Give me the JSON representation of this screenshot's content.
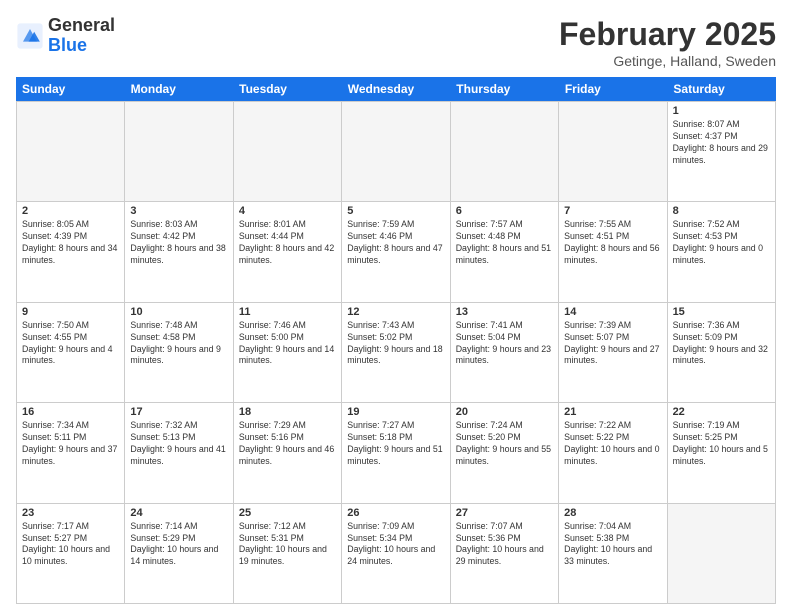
{
  "header": {
    "logo_general": "General",
    "logo_blue": "Blue",
    "month_title": "February 2025",
    "location": "Getinge, Halland, Sweden"
  },
  "days_of_week": [
    "Sunday",
    "Monday",
    "Tuesday",
    "Wednesday",
    "Thursday",
    "Friday",
    "Saturday"
  ],
  "weeks": [
    [
      {
        "num": "",
        "info": "",
        "empty": true
      },
      {
        "num": "",
        "info": "",
        "empty": true
      },
      {
        "num": "",
        "info": "",
        "empty": true
      },
      {
        "num": "",
        "info": "",
        "empty": true
      },
      {
        "num": "",
        "info": "",
        "empty": true
      },
      {
        "num": "",
        "info": "",
        "empty": true
      },
      {
        "num": "1",
        "info": "Sunrise: 8:07 AM\nSunset: 4:37 PM\nDaylight: 8 hours and 29 minutes.",
        "empty": false
      }
    ],
    [
      {
        "num": "2",
        "info": "Sunrise: 8:05 AM\nSunset: 4:39 PM\nDaylight: 8 hours and 34 minutes.",
        "empty": false
      },
      {
        "num": "3",
        "info": "Sunrise: 8:03 AM\nSunset: 4:42 PM\nDaylight: 8 hours and 38 minutes.",
        "empty": false
      },
      {
        "num": "4",
        "info": "Sunrise: 8:01 AM\nSunset: 4:44 PM\nDaylight: 8 hours and 42 minutes.",
        "empty": false
      },
      {
        "num": "5",
        "info": "Sunrise: 7:59 AM\nSunset: 4:46 PM\nDaylight: 8 hours and 47 minutes.",
        "empty": false
      },
      {
        "num": "6",
        "info": "Sunrise: 7:57 AM\nSunset: 4:48 PM\nDaylight: 8 hours and 51 minutes.",
        "empty": false
      },
      {
        "num": "7",
        "info": "Sunrise: 7:55 AM\nSunset: 4:51 PM\nDaylight: 8 hours and 56 minutes.",
        "empty": false
      },
      {
        "num": "8",
        "info": "Sunrise: 7:52 AM\nSunset: 4:53 PM\nDaylight: 9 hours and 0 minutes.",
        "empty": false
      }
    ],
    [
      {
        "num": "9",
        "info": "Sunrise: 7:50 AM\nSunset: 4:55 PM\nDaylight: 9 hours and 4 minutes.",
        "empty": false
      },
      {
        "num": "10",
        "info": "Sunrise: 7:48 AM\nSunset: 4:58 PM\nDaylight: 9 hours and 9 minutes.",
        "empty": false
      },
      {
        "num": "11",
        "info": "Sunrise: 7:46 AM\nSunset: 5:00 PM\nDaylight: 9 hours and 14 minutes.",
        "empty": false
      },
      {
        "num": "12",
        "info": "Sunrise: 7:43 AM\nSunset: 5:02 PM\nDaylight: 9 hours and 18 minutes.",
        "empty": false
      },
      {
        "num": "13",
        "info": "Sunrise: 7:41 AM\nSunset: 5:04 PM\nDaylight: 9 hours and 23 minutes.",
        "empty": false
      },
      {
        "num": "14",
        "info": "Sunrise: 7:39 AM\nSunset: 5:07 PM\nDaylight: 9 hours and 27 minutes.",
        "empty": false
      },
      {
        "num": "15",
        "info": "Sunrise: 7:36 AM\nSunset: 5:09 PM\nDaylight: 9 hours and 32 minutes.",
        "empty": false
      }
    ],
    [
      {
        "num": "16",
        "info": "Sunrise: 7:34 AM\nSunset: 5:11 PM\nDaylight: 9 hours and 37 minutes.",
        "empty": false
      },
      {
        "num": "17",
        "info": "Sunrise: 7:32 AM\nSunset: 5:13 PM\nDaylight: 9 hours and 41 minutes.",
        "empty": false
      },
      {
        "num": "18",
        "info": "Sunrise: 7:29 AM\nSunset: 5:16 PM\nDaylight: 9 hours and 46 minutes.",
        "empty": false
      },
      {
        "num": "19",
        "info": "Sunrise: 7:27 AM\nSunset: 5:18 PM\nDaylight: 9 hours and 51 minutes.",
        "empty": false
      },
      {
        "num": "20",
        "info": "Sunrise: 7:24 AM\nSunset: 5:20 PM\nDaylight: 9 hours and 55 minutes.",
        "empty": false
      },
      {
        "num": "21",
        "info": "Sunrise: 7:22 AM\nSunset: 5:22 PM\nDaylight: 10 hours and 0 minutes.",
        "empty": false
      },
      {
        "num": "22",
        "info": "Sunrise: 7:19 AM\nSunset: 5:25 PM\nDaylight: 10 hours and 5 minutes.",
        "empty": false
      }
    ],
    [
      {
        "num": "23",
        "info": "Sunrise: 7:17 AM\nSunset: 5:27 PM\nDaylight: 10 hours and 10 minutes.",
        "empty": false
      },
      {
        "num": "24",
        "info": "Sunrise: 7:14 AM\nSunset: 5:29 PM\nDaylight: 10 hours and 14 minutes.",
        "empty": false
      },
      {
        "num": "25",
        "info": "Sunrise: 7:12 AM\nSunset: 5:31 PM\nDaylight: 10 hours and 19 minutes.",
        "empty": false
      },
      {
        "num": "26",
        "info": "Sunrise: 7:09 AM\nSunset: 5:34 PM\nDaylight: 10 hours and 24 minutes.",
        "empty": false
      },
      {
        "num": "27",
        "info": "Sunrise: 7:07 AM\nSunset: 5:36 PM\nDaylight: 10 hours and 29 minutes.",
        "empty": false
      },
      {
        "num": "28",
        "info": "Sunrise: 7:04 AM\nSunset: 5:38 PM\nDaylight: 10 hours and 33 minutes.",
        "empty": false
      },
      {
        "num": "",
        "info": "",
        "empty": true
      }
    ]
  ]
}
